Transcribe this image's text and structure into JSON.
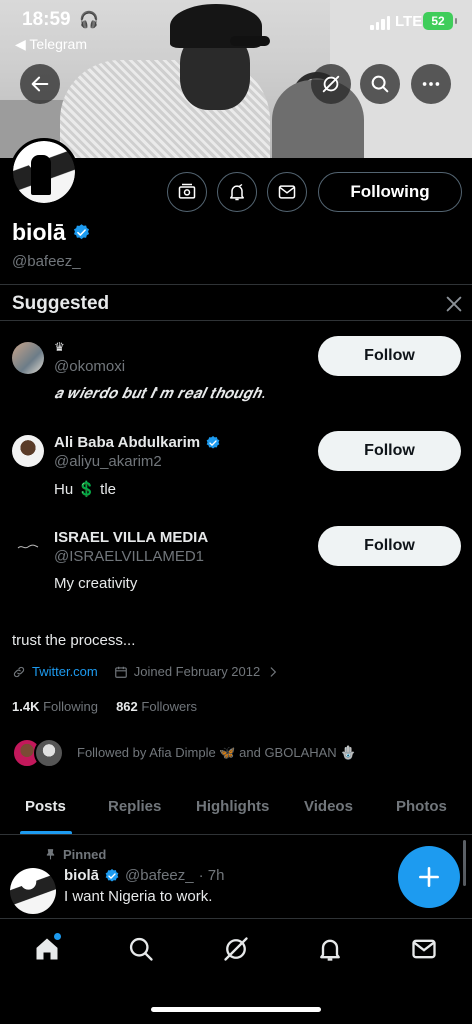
{
  "status_bar": {
    "time": "18:59",
    "back_app": "◀ Telegram",
    "network": "LTE",
    "battery": "52"
  },
  "profile": {
    "name": "biolā",
    "handle": "@bafeez_",
    "following_button": "Following",
    "bio": "trust the process...",
    "link": "Twitter.com",
    "joined": "Joined February 2012",
    "following_count": "1.4K",
    "following_label": "Following",
    "followers_count": "862",
    "followers_label": "Followers",
    "followed_by": "Followed by Afia Dimple 🦋 and GBOLAHAN 🪬"
  },
  "suggested": {
    "title": "Suggested",
    "follow_label": "Follow",
    "items": [
      {
        "name": "♛",
        "handle": "@okomoxi",
        "bio": "𝒂 𝒘𝒊𝒆𝒓𝒅𝒐 𝒃𝒖𝒕 𝑰'𝒎 𝒓𝒆𝒂𝒍 𝒕𝒉𝒐𝒖𝒈𝒉.",
        "verified": false
      },
      {
        "name": "Ali Baba Abdulkarim",
        "handle": "@aliyu_akarim2",
        "bio": "Hu 💲 tle",
        "verified": true
      },
      {
        "name": "ISRAEL VILLA MEDIA",
        "handle": "@ISRAELVILLAMED1",
        "bio": "My creativity",
        "verified": false
      }
    ]
  },
  "tabs": [
    {
      "label": "Posts",
      "active": true
    },
    {
      "label": "Replies"
    },
    {
      "label": "Highlights"
    },
    {
      "label": "Videos"
    },
    {
      "label": "Photos"
    }
  ],
  "pinned_post": {
    "pinned_label": "Pinned",
    "name": "biolā",
    "handle": "@bafeez_",
    "time": "· 7h",
    "text": "I want Nigeria to work."
  },
  "colors": {
    "accent": "#1d9bf0",
    "background": "#000000",
    "muted": "#71767b",
    "border": "#2f3336"
  },
  "icons": {
    "header": [
      "back-arrow-icon",
      "grok-icon",
      "search-icon",
      "more-icon"
    ],
    "actions": [
      "subscriptions-icon",
      "notification-bell-icon",
      "message-icon"
    ],
    "bottom_nav": [
      "home-icon",
      "search-icon",
      "grok-icon",
      "notifications-icon",
      "messages-icon"
    ]
  }
}
